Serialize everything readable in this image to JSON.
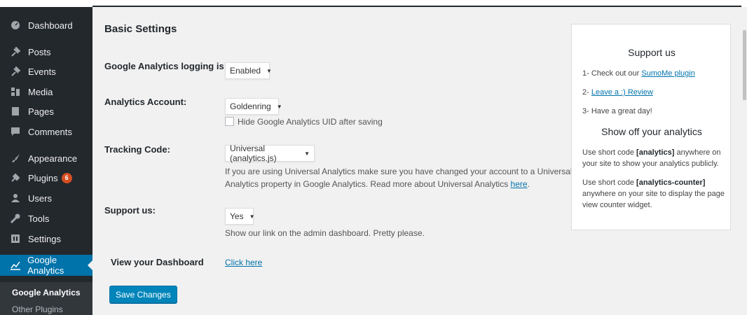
{
  "sidebar": {
    "items": [
      {
        "label": "Dashboard",
        "icon": "dashboard-icon"
      },
      {
        "label": "Posts",
        "icon": "pin-icon"
      },
      {
        "label": "Events",
        "icon": "pin-icon"
      },
      {
        "label": "Media",
        "icon": "media-icon"
      },
      {
        "label": "Pages",
        "icon": "pages-icon"
      },
      {
        "label": "Comments",
        "icon": "comments-icon"
      },
      {
        "label": "Appearance",
        "icon": "brush-icon"
      },
      {
        "label": "Plugins",
        "icon": "plugin-icon",
        "badge": "6"
      },
      {
        "label": "Users",
        "icon": "users-icon"
      },
      {
        "label": "Tools",
        "icon": "wrench-icon"
      },
      {
        "label": "Settings",
        "icon": "settings-icon"
      },
      {
        "label": "Google Analytics",
        "icon": "chart-icon"
      }
    ],
    "submenu": [
      "Google Analytics",
      "Other Plugins"
    ]
  },
  "main": {
    "title": "Basic Settings",
    "logging": {
      "label": "Google Analytics logging is:",
      "value": "Enabled"
    },
    "account": {
      "label": "Analytics Account:",
      "value": "Goldenring",
      "checkbox_label": "Hide Google Analytics UID after saving"
    },
    "tracking": {
      "label": "Tracking Code:",
      "value": "Universal (analytics.js)",
      "desc_line1": "If you are using Universal Analytics make sure you have changed your account to a Universal",
      "desc_line2": "Analytics property in Google Analytics. Read more about Universal Analytics",
      "desc_link": "here",
      "desc_end": "."
    },
    "support": {
      "label": "Support us:",
      "value": "Yes",
      "desc": "Show our link on the admin dashboard. Pretty please."
    },
    "dashboard": {
      "label": "View your Dashboard",
      "link": "Click here"
    },
    "save_button": "Save Changes"
  },
  "support_box": {
    "title": "Support us",
    "item1_prefix": "1- Check out our",
    "item1_link": "SumoMe plugin",
    "item2_prefix": "2-",
    "item2_link": "Leave a :) Review",
    "item3": "3- Have a great day!",
    "analytics_title": "Show off your analytics",
    "p1_pre": "Use short code",
    "p1_code": "[analytics]",
    "p1_post": "anywhere on your site to show your analytics publicly.",
    "p2_pre": "Use short code",
    "p2_code": "[analytics-counter]",
    "p2_post": "anywhere on your site to display the page view counter widget."
  },
  "colors": {
    "sidebar_bg": "#23282d",
    "accent": "#0073aa",
    "button": "#0085ba",
    "badge": "#d54e21"
  }
}
